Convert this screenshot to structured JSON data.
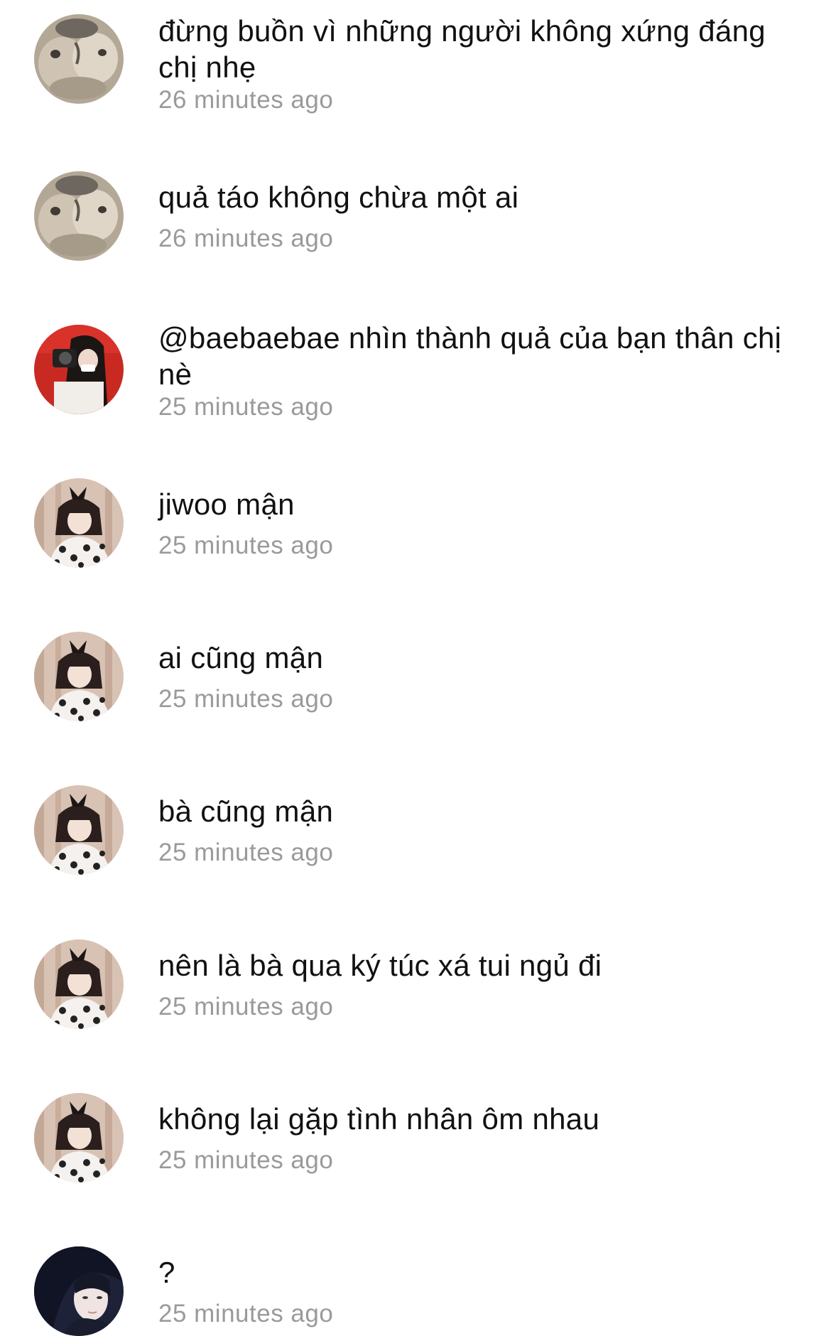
{
  "comments": [
    {
      "text": "đừng buồn vì những người không xứng đáng chị nhẹ",
      "time": "26 minutes ago",
      "avatar": "cat-kiss-avatar-icon"
    },
    {
      "text": "quả táo không chừa một ai",
      "time": "26 minutes ago",
      "avatar": "cat-kiss-avatar-icon"
    },
    {
      "text": "@baebaebae nhìn thành quả của bạn thân chị nè",
      "time": "25 minutes ago",
      "avatar": "camera-girl-avatar-icon"
    },
    {
      "text": "jiwoo mận",
      "time": "25 minutes ago",
      "avatar": "bow-girl-avatar-icon"
    },
    {
      "text": "ai cũng mận",
      "time": "25 minutes ago",
      "avatar": "bow-girl-avatar-icon"
    },
    {
      "text": "bà cũng mận",
      "time": "25 minutes ago",
      "avatar": "bow-girl-avatar-icon"
    },
    {
      "text": "nên là bà qua ký túc xá tui ngủ đi",
      "time": "25 minutes ago",
      "avatar": "bow-girl-avatar-icon"
    },
    {
      "text": "không lại gặp tình nhân ôm nhau",
      "time": "25 minutes ago",
      "avatar": "bow-girl-avatar-icon"
    },
    {
      "text": "?",
      "time": "25 minutes ago",
      "avatar": "dark-hair-girl-avatar-icon"
    }
  ],
  "colors": {
    "text": "#111111",
    "timestamp": "#9a9a9a",
    "background": "#ffffff"
  }
}
